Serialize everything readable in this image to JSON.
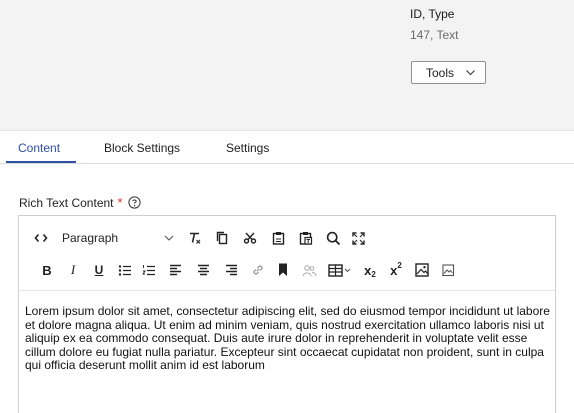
{
  "header": {
    "id_type_label": "ID, Type",
    "id_type_value": "147, Text",
    "tools_label": "Tools"
  },
  "tabs": [
    {
      "label": "Content",
      "active": true
    },
    {
      "label": "Block Settings",
      "active": false
    },
    {
      "label": "Settings",
      "active": false
    }
  ],
  "field": {
    "label": "Rich Text Content",
    "required_mark": "*"
  },
  "editor": {
    "toolbar_row1": [
      {
        "name": "source-code-icon"
      },
      {
        "name": "paragraph-format-select",
        "label": "Paragraph"
      },
      {
        "name": "clear-format-icon"
      },
      {
        "name": "copy-icon"
      },
      {
        "name": "cut-icon"
      },
      {
        "name": "paste-icon"
      },
      {
        "name": "paste-text-icon"
      },
      {
        "name": "find-icon"
      },
      {
        "name": "fullscreen-icon"
      }
    ],
    "toolbar_row2": [
      {
        "name": "bold-icon",
        "glyph": "B"
      },
      {
        "name": "italic-icon",
        "glyph": "I"
      },
      {
        "name": "underline-icon",
        "glyph": "U"
      },
      {
        "name": "bullet-list-icon"
      },
      {
        "name": "numbered-list-icon"
      },
      {
        "name": "align-left-icon"
      },
      {
        "name": "align-center-icon"
      },
      {
        "name": "align-right-icon"
      },
      {
        "name": "link-icon"
      },
      {
        "name": "bookmark-icon"
      },
      {
        "name": "people-icon"
      },
      {
        "name": "table-icon"
      },
      {
        "name": "subscript-icon",
        "glyph": "x"
      },
      {
        "name": "superscript-icon",
        "glyph": "x"
      },
      {
        "name": "image-icon"
      },
      {
        "name": "media-icon"
      }
    ],
    "content": "Lorem ipsum dolor sit amet, consectetur adipiscing elit, sed do eiusmod tempor incididunt ut labore et dolore magna aliqua. Ut enim ad minim veniam, quis nostrud exercitation ullamco laboris nisi ut aliquip ex ea commodo consequat. Duis aute irure dolor in reprehenderit in voluptate velit esse cillum dolore eu fugiat nulla pariatur. Excepteur sint occaecat cupidatat non proident, sunt in culpa qui officia deserunt mollit anim id est laborum"
  },
  "colors": {
    "accent": "#2f4fa6",
    "required": "#d62d2d",
    "header_bg": "#f3f3f3"
  }
}
